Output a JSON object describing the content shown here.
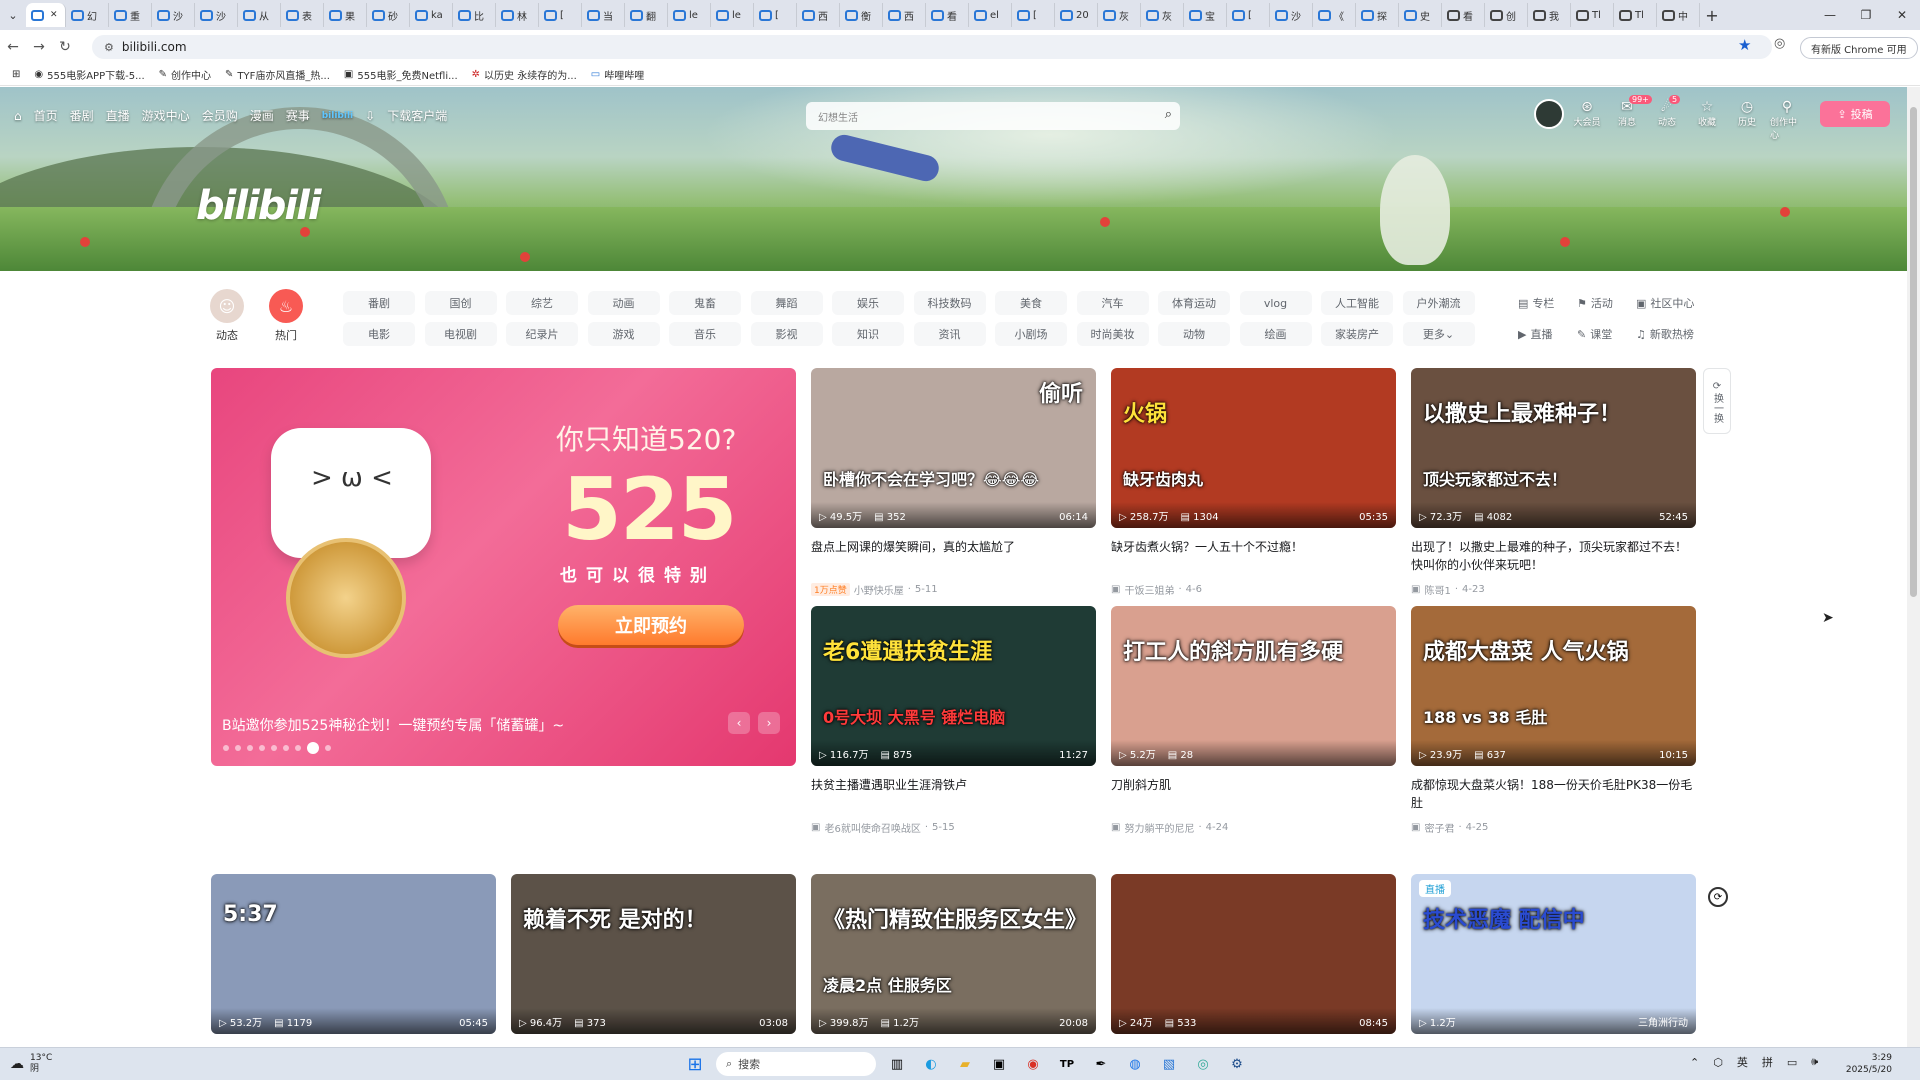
{
  "browser": {
    "tabs": [
      {
        "label": "",
        "active": true
      },
      {
        "label": "幻"
      },
      {
        "label": "重"
      },
      {
        "label": "沙"
      },
      {
        "label": "沙"
      },
      {
        "label": "从"
      },
      {
        "label": "表"
      },
      {
        "label": "果"
      },
      {
        "label": "砂"
      },
      {
        "label": "ka"
      },
      {
        "label": "比"
      },
      {
        "label": "林"
      },
      {
        "label": "["
      },
      {
        "label": "当"
      },
      {
        "label": "翻"
      },
      {
        "label": "le"
      },
      {
        "label": "le"
      },
      {
        "label": "["
      },
      {
        "label": "西"
      },
      {
        "label": "衡"
      },
      {
        "label": "西"
      },
      {
        "label": "看"
      },
      {
        "label": "el"
      },
      {
        "label": "["
      },
      {
        "label": "20"
      },
      {
        "label": "灰"
      },
      {
        "label": "灰"
      },
      {
        "label": "宝"
      },
      {
        "label": "["
      },
      {
        "label": "沙"
      },
      {
        "label": "《"
      },
      {
        "label": "探"
      },
      {
        "label": "史"
      },
      {
        "label": "看"
      },
      {
        "label": "创"
      },
      {
        "label": "我"
      },
      {
        "label": "Tl"
      },
      {
        "label": "Tl"
      },
      {
        "label": "中"
      }
    ],
    "url": "bilibili.com",
    "update_label": "有新版 Chrome 可用",
    "bookmarks": [
      "555电影APP下载-5...",
      "创作中心",
      "TYF庙亦风直播_热...",
      "555电影_免费Netfli...",
      "以历史 永续存的为...",
      "哔哩哔哩"
    ]
  },
  "header": {
    "nav": [
      "首页",
      "番剧",
      "直播",
      "游戏中心",
      "会员购",
      "漫画",
      "赛事",
      "bilibili",
      "下载客户端"
    ],
    "logo": "bilibili",
    "search_placeholder": "幻想生活",
    "right_icons": [
      {
        "label": "大会员",
        "icon": "vip-icon",
        "badge": ""
      },
      {
        "label": "消息",
        "icon": "message-icon",
        "badge": "99+"
      },
      {
        "label": "动态",
        "icon": "dynamic-icon",
        "badge": "5"
      },
      {
        "label": "收藏",
        "icon": "favorite-icon",
        "badge": ""
      },
      {
        "label": "历史",
        "icon": "history-icon",
        "badge": ""
      },
      {
        "label": "创作中心",
        "icon": "creator-icon",
        "badge": ""
      }
    ],
    "upload_label": "投稿"
  },
  "channels": {
    "dynamic_label": "动态",
    "hot_label": "热门",
    "row1": [
      "番剧",
      "国创",
      "综艺",
      "动画",
      "鬼畜",
      "舞蹈",
      "娱乐",
      "科技数码",
      "美食",
      "汽车",
      "体育运动",
      "vlog",
      "人工智能",
      "户外潮流"
    ],
    "row2": [
      "电影",
      "电视剧",
      "纪录片",
      "游戏",
      "音乐",
      "影视",
      "知识",
      "资讯",
      "小剧场",
      "时尚美妆",
      "动物",
      "绘画",
      "家装房产",
      "更多"
    ],
    "right_links": [
      "专栏",
      "活动",
      "社区中心",
      "直播",
      "课堂",
      "新歌热榜"
    ]
  },
  "carousel": {
    "question": "你只知道520?",
    "number": "525",
    "subtitle": "也可以很特别",
    "cta": "立即预约",
    "caption": "B站邀你参加525神秘企划！一键预约专属「储蓄罐」~"
  },
  "side_refresh": "换一换",
  "cards": [
    {
      "overlay": "偷听",
      "overlay2": "卧槽你不会在学习吧？😂😂😂",
      "views": "49.5万",
      "danmaku": "352",
      "duration": "06:14",
      "title": "盘点上网课的爆笑瞬间，真的太尴尬了",
      "tag": "1万点赞",
      "author": "小野快乐屋",
      "date": "5-11",
      "bg": "#b9a8a0"
    },
    {
      "overlay": "火锅",
      "overlay2": "缺牙齿肉丸",
      "views": "258.7万",
      "danmaku": "1304",
      "duration": "05:35",
      "title": "缺牙齿煮火锅？一人五十个不过瘾！",
      "tag": "",
      "author": "干饭三姐弟",
      "date": "4-6",
      "bg": "#b23a22"
    },
    {
      "overlay": "以撒史上最难种子！",
      "overlay2": "顶尖玩家都过不去！",
      "views": "72.3万",
      "danmaku": "4082",
      "duration": "52:45",
      "title": "出现了！以撒史上最难的种子，顶尖玩家都过不去！快叫你的小伙伴来玩吧！",
      "tag": "",
      "author": "陈哥1",
      "date": "4-23",
      "bg": "#6a5040"
    },
    {
      "overlay": "老6遭遇扶贫生涯",
      "overlay2": "0号大坝 大黑号 锤烂电脑",
      "views": "116.7万",
      "danmaku": "875",
      "duration": "11:27",
      "title": "扶贫主播遭遇职业生涯滑铁卢",
      "tag": "",
      "author": "老6就叫使命召唤战区",
      "date": "5-15",
      "bg": "#1f3b35"
    },
    {
      "overlay": "打工人的斜方肌有多硬",
      "overlay2": "",
      "views": "5.2万",
      "danmaku": "28",
      "duration": "",
      "title": "刀削斜方肌",
      "tag": "",
      "author": "努力躺平的尼尼",
      "date": "4-24",
      "bg": "#d9a08f"
    },
    {
      "overlay": "成都大盘菜 人气火锅",
      "overlay2": "188 vs 38 毛肚",
      "views": "23.9万",
      "danmaku": "637",
      "duration": "10:15",
      "title": "成都惊现大盘菜火锅！188一份天价毛肚PK38一份毛肚",
      "tag": "",
      "author": "密子君",
      "date": "4-25",
      "bg": "#a46a3a"
    },
    {
      "overlay": "5:37",
      "overlay2": "",
      "views": "53.2万",
      "danmaku": "1179",
      "duration": "05:45",
      "title": "",
      "tag": "",
      "author": "",
      "date": "",
      "bg": "#8a9ab8"
    },
    {
      "overlay": "赖着不死 是对的！",
      "overlay2": "",
      "views": "96.4万",
      "danmaku": "373",
      "duration": "03:08",
      "title": "",
      "tag": "",
      "author": "",
      "date": "",
      "bg": "#5c5248"
    },
    {
      "overlay": "《热门精致住服务区女生》",
      "overlay2": "凌晨2点 住服务区",
      "views": "399.8万",
      "danmaku": "1.2万",
      "duration": "20:08",
      "title": "",
      "tag": "",
      "author": "",
      "date": "",
      "bg": "#7a6e60"
    },
    {
      "overlay": "",
      "overlay2": "",
      "views": "24万",
      "danmaku": "533",
      "duration": "08:45",
      "title": "",
      "tag": "",
      "author": "",
      "date": "",
      "bg": "#7a3a26"
    },
    {
      "overlay": "技术恶魔 配信中",
      "overlay2": "",
      "views": "1.2万",
      "danmaku": "",
      "duration": "三角洲行动",
      "live": "直播",
      "title": "",
      "tag": "",
      "author": "",
      "date": "",
      "bg": "#c6d6ef"
    }
  ],
  "taskbar": {
    "weather_temp": "13°C",
    "weather_desc": "阴",
    "search_label": "搜索",
    "ime": "英",
    "ime2": "拼",
    "time": "3:29",
    "date": "2025/5/20"
  }
}
